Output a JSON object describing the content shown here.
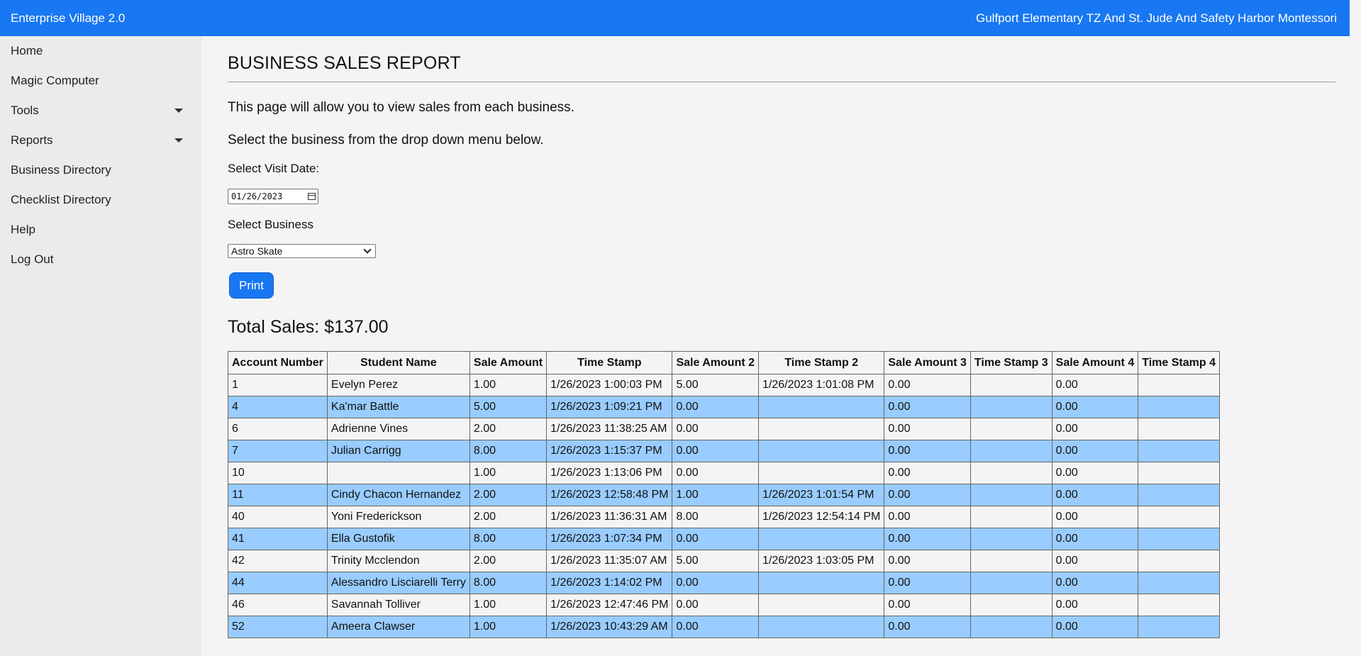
{
  "header": {
    "app_title": "Enterprise Village 2.0",
    "org_name": "Gulfport Elementary TZ And St. Jude And Safety Harbor Montessori"
  },
  "sidebar": {
    "items": [
      {
        "label": "Home",
        "has_dropdown": false
      },
      {
        "label": "Magic Computer",
        "has_dropdown": false
      },
      {
        "label": "Tools",
        "has_dropdown": true
      },
      {
        "label": "Reports",
        "has_dropdown": true
      },
      {
        "label": "Business Directory",
        "has_dropdown": false
      },
      {
        "label": "Checklist Directory",
        "has_dropdown": false
      },
      {
        "label": "Help",
        "has_dropdown": false
      },
      {
        "label": "Log Out",
        "has_dropdown": false
      }
    ]
  },
  "main": {
    "title": "BUSINESS SALES REPORT",
    "intro_line1": "This page will allow you to view sales from each business.",
    "intro_line2": "Select the business from the drop down menu below.",
    "date_label": "Select Visit Date:",
    "date_value": "01/26/2023",
    "business_label": "Select Business",
    "business_selected": "Astro Skate",
    "print_label": "Print",
    "total_sales": "Total Sales: $137.00"
  },
  "table": {
    "headers": [
      "Account Number",
      "Student Name",
      "Sale Amount",
      "Time Stamp",
      "Sale Amount 2",
      "Time Stamp 2",
      "Sale Amount 3",
      "Time Stamp 3",
      "Sale Amount 4",
      "Time Stamp 4"
    ],
    "rows": [
      [
        "1",
        "Evelyn Perez",
        "1.00",
        "1/26/2023 1:00:03 PM",
        "5.00",
        "1/26/2023 1:01:08 PM",
        "0.00",
        "",
        "0.00",
        ""
      ],
      [
        "4",
        "Ka'mar Battle",
        "5.00",
        "1/26/2023 1:09:21 PM",
        "0.00",
        "",
        "0.00",
        "",
        "0.00",
        ""
      ],
      [
        "6",
        "Adrienne Vines",
        "2.00",
        "1/26/2023 11:38:25 AM",
        "0.00",
        "",
        "0.00",
        "",
        "0.00",
        ""
      ],
      [
        "7",
        "Julian Carrigg",
        "8.00",
        "1/26/2023 1:15:37 PM",
        "0.00",
        "",
        "0.00",
        "",
        "0.00",
        ""
      ],
      [
        "10",
        "",
        "1.00",
        "1/26/2023 1:13:06 PM",
        "0.00",
        "",
        "0.00",
        "",
        "0.00",
        ""
      ],
      [
        "11",
        "Cindy Chacon Hernandez",
        "2.00",
        "1/26/2023 12:58:48 PM",
        "1.00",
        "1/26/2023 1:01:54 PM",
        "0.00",
        "",
        "0.00",
        ""
      ],
      [
        "40",
        "Yoni Frederickson",
        "2.00",
        "1/26/2023 11:36:31 AM",
        "8.00",
        "1/26/2023 12:54:14 PM",
        "0.00",
        "",
        "0.00",
        ""
      ],
      [
        "41",
        "Ella Gustofik",
        "8.00",
        "1/26/2023 1:07:34 PM",
        "0.00",
        "",
        "0.00",
        "",
        "0.00",
        ""
      ],
      [
        "42",
        "Trinity Mcclendon",
        "2.00",
        "1/26/2023 11:35:07 AM",
        "5.00",
        "1/26/2023 1:03:05 PM",
        "0.00",
        "",
        "0.00",
        ""
      ],
      [
        "44",
        "Alessandro Lisciarelli Terry",
        "8.00",
        "1/26/2023 1:14:02 PM",
        "0.00",
        "",
        "0.00",
        "",
        "0.00",
        ""
      ],
      [
        "46",
        "Savannah Tolliver",
        "1.00",
        "1/26/2023 12:47:46 PM",
        "0.00",
        "",
        "0.00",
        "",
        "0.00",
        ""
      ],
      [
        "52",
        "Ameera Clawser",
        "1.00",
        "1/26/2023 10:43:29 AM",
        "0.00",
        "",
        "0.00",
        "",
        "0.00",
        ""
      ]
    ]
  }
}
